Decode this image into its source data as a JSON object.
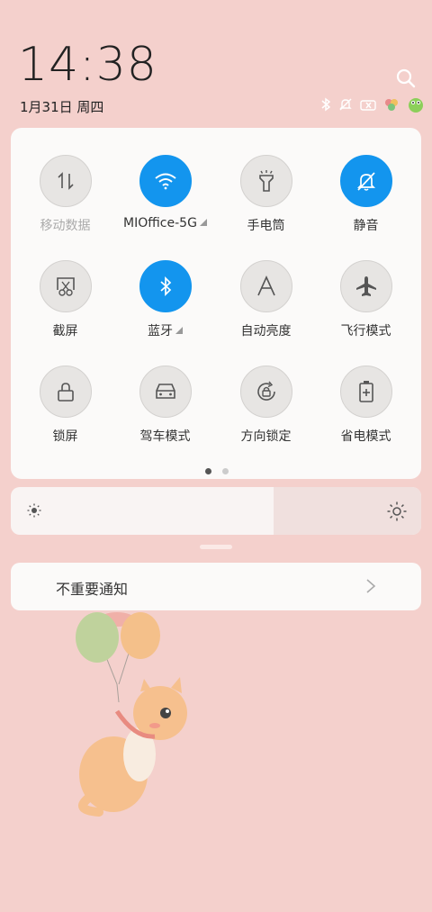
{
  "status": {
    "time": "14:38",
    "date": "1月31日 周四"
  },
  "quick_settings": [
    {
      "label": "移动数据",
      "icon": "mobile-data-icon",
      "on": false,
      "disabled": true
    },
    {
      "label": "MIOffice-5G",
      "icon": "wifi-icon",
      "on": true
    },
    {
      "label": "手电筒",
      "icon": "flashlight-icon",
      "on": false
    },
    {
      "label": "静音",
      "icon": "silent-bell-icon",
      "on": true
    },
    {
      "label": "截屏",
      "icon": "screenshot-icon",
      "on": false
    },
    {
      "label": "蓝牙",
      "icon": "bluetooth-icon",
      "on": true
    },
    {
      "label": "自动亮度",
      "icon": "auto-brightness-icon",
      "on": false
    },
    {
      "label": "飞行模式",
      "icon": "airplane-icon",
      "on": false
    },
    {
      "label": "锁屏",
      "icon": "lock-icon",
      "on": false
    },
    {
      "label": "驾车模式",
      "icon": "car-icon",
      "on": false
    },
    {
      "label": "方向锁定",
      "icon": "rotation-lock-icon",
      "on": false
    },
    {
      "label": "省电模式",
      "icon": "battery-saver-icon",
      "on": false
    }
  ],
  "page_indicator": {
    "count": 2,
    "active": 0
  },
  "brightness": {
    "level": 0.64
  },
  "notification": {
    "label": "不重要通知"
  },
  "colors": {
    "accent": "#1395ee",
    "panel": "#fbfaf9",
    "background": "#f4d0cc"
  }
}
